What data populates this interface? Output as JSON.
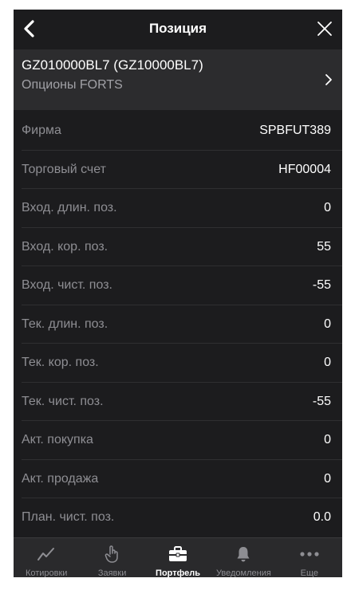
{
  "header": {
    "title": "Позиция"
  },
  "instrument": {
    "code": "GZ010000BL7 (GZ10000BL7)",
    "market": "Опционы FORTS"
  },
  "rows": [
    {
      "label": "Фирма",
      "value": "SPBFUT389"
    },
    {
      "label": "Торговый счет",
      "value": "HF00004"
    },
    {
      "label": "Вход. длин. поз.",
      "value": "0"
    },
    {
      "label": "Вход. кор. поз.",
      "value": "55"
    },
    {
      "label": "Вход. чист. поз.",
      "value": "-55"
    },
    {
      "label": "Тек. длин. поз.",
      "value": "0"
    },
    {
      "label": "Тек. кор. поз.",
      "value": "0"
    },
    {
      "label": "Тек. чист. поз.",
      "value": "-55"
    },
    {
      "label": "Акт. покупка",
      "value": "0"
    },
    {
      "label": "Акт. продажа",
      "value": "0"
    },
    {
      "label": "План. чист. поз.",
      "value": "0.0"
    }
  ],
  "tabbar": {
    "tabs": [
      {
        "label": "Котировки",
        "icon": "chart-line-icon",
        "active": false
      },
      {
        "label": "Заявки",
        "icon": "hand-icon",
        "active": false
      },
      {
        "label": "Портфель",
        "icon": "briefcase-icon",
        "active": true
      },
      {
        "label": "Уведомления",
        "icon": "bell-icon",
        "active": false
      },
      {
        "label": "Еще",
        "icon": "more-icon",
        "active": false
      }
    ]
  },
  "colors": {
    "background": "#1c1c1e",
    "header_background": "#2c2c2e",
    "label_text": "#8e8e93",
    "value_text": "#ffffff",
    "tab_active": "#ffffff",
    "tab_inactive": "#8e8e93"
  }
}
